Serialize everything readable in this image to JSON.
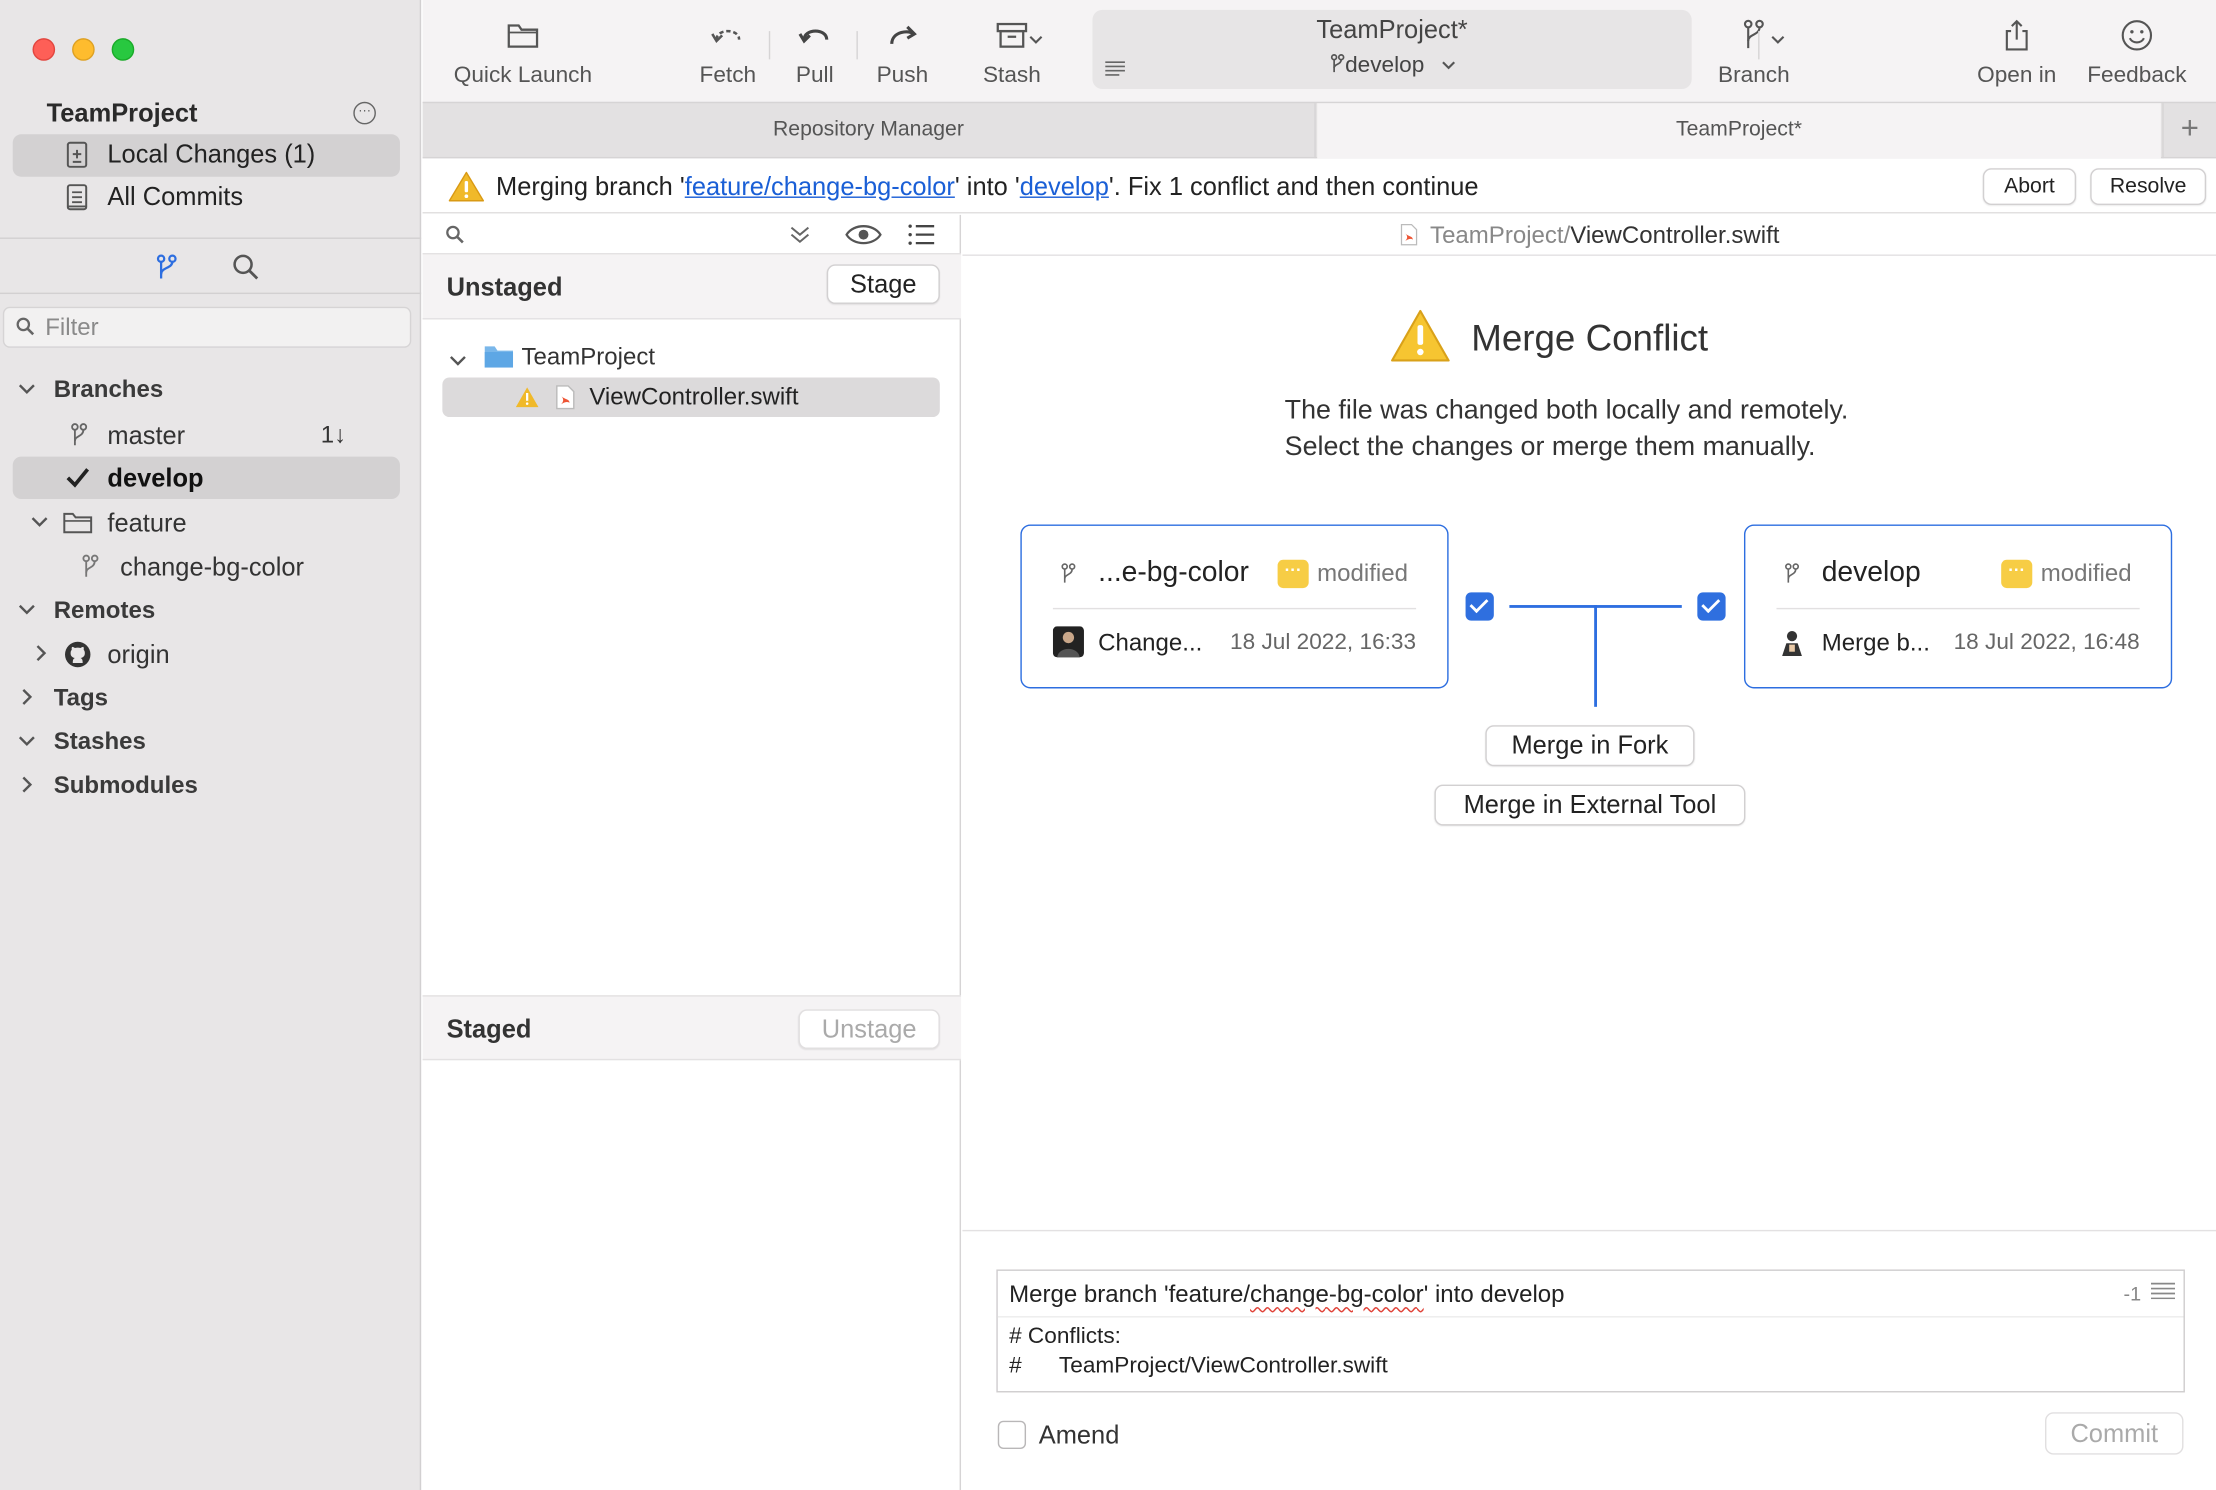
{
  "sidebar": {
    "repo_title": "TeamProject",
    "nav": [
      {
        "label": "Local Changes (1)",
        "selected": true
      },
      {
        "label": "All Commits",
        "selected": false
      }
    ],
    "filter_placeholder": "Filter",
    "tree": {
      "branches_header": "Branches",
      "master": "master",
      "master_sync": "1↓",
      "develop": "develop",
      "feature_folder": "feature",
      "feature_branch": "change-bg-color",
      "remotes_header": "Remotes",
      "origin": "origin",
      "tags_header": "Tags",
      "stashes_header": "Stashes",
      "submodules_header": "Submodules"
    }
  },
  "toolbar": {
    "quick_launch": "Quick Launch",
    "fetch": "Fetch",
    "pull": "Pull",
    "push": "Push",
    "stash": "Stash",
    "repo_name": "TeamProject*",
    "current_branch": "develop",
    "branch": "Branch",
    "open_in": "Open in",
    "feedback": "Feedback"
  },
  "tabs": [
    {
      "label": "Repository Manager",
      "active": false
    },
    {
      "label": "TeamProject*",
      "active": true
    }
  ],
  "banner": {
    "prefix": "Merging branch '",
    "source_branch": "feature/change-bg-color",
    "middle": "' into '",
    "target_branch": "develop",
    "suffix": "'. Fix 1 conflict and then continue",
    "abort": "Abort",
    "resolve": "Resolve"
  },
  "filepane": {
    "unstaged_title": "Unstaged",
    "stage_button": "Stage",
    "folder": "TeamProject",
    "file": "ViewController.swift",
    "staged_title": "Staged",
    "unstage_button": "Unstage"
  },
  "detail": {
    "path_dir": "TeamProject/",
    "path_file": "ViewController.swift",
    "title": "Merge Conflict",
    "desc_line1": "The file was changed both locally and remotely.",
    "desc_line2": "Select the changes or merge them manually.",
    "left_card": {
      "branch": "...e-bg-color",
      "status": "modified",
      "message": "Change...",
      "date": "18 Jul 2022, 16:33"
    },
    "right_card": {
      "branch": "develop",
      "status": "modified",
      "message": "Merge b...",
      "date": "18 Jul 2022, 16:48"
    },
    "merge_in_fork": "Merge in Fork",
    "merge_external": "Merge in External Tool"
  },
  "commit": {
    "subject_before": "Merge branch 'feature/",
    "subject_spell": "change-bg-color",
    "subject_after": "' into develop",
    "body": "# Conflicts:\n#      TeamProject/ViewController.swift",
    "count": "-1",
    "amend": "Amend",
    "commit_button": "Commit"
  },
  "colors": {
    "accent": "#2d6ee0",
    "link": "#1a5fd6",
    "badge": "#f7cd45",
    "warning": "#f0b92a",
    "sidebar_bg": "#e8e6e7"
  }
}
